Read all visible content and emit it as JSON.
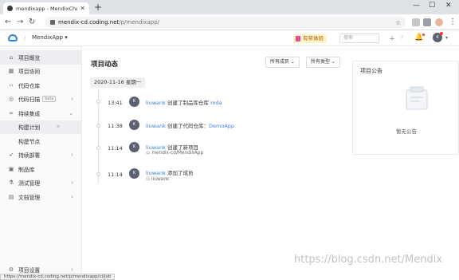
{
  "browser": {
    "tab_title": "mendixapp - MendixChengdu",
    "new_tab": "+",
    "url_host": "mendix-cd.coding.net",
    "url_path": "/p/mendixapp/",
    "window_controls": [
      "—",
      "☐",
      "✕"
    ],
    "status_url": "https://mendix-cd.coding.net/p/mendixapp/ci/job"
  },
  "header": {
    "project_name": "MendixApp",
    "promo_label": "有奖体验",
    "search_placeholder": "搜索",
    "user_initial": "K"
  },
  "sidebar": {
    "items": [
      {
        "label": "项目概览",
        "icon": "home-icon"
      },
      {
        "label": "项目协同",
        "icon": "calendar-icon"
      },
      {
        "label": "代码仓库",
        "icon": "code-icon"
      },
      {
        "label": "代码扫描",
        "icon": "scan-icon",
        "badge": "beta"
      },
      {
        "label": "持续集成",
        "icon": "infinity-icon"
      },
      {
        "label": "构建计划",
        "sub": true
      },
      {
        "label": "构建节点",
        "sub": true
      },
      {
        "label": "持续部署",
        "icon": "rocket-icon"
      },
      {
        "label": "制品库",
        "icon": "box-icon"
      },
      {
        "label": "测试管理",
        "icon": "flask-icon"
      },
      {
        "label": "文档管理",
        "icon": "doc-icon"
      }
    ],
    "footer_label": "项目设置"
  },
  "main": {
    "title": "项目动态",
    "filter_members": "所有成员",
    "filter_types": "所有类型",
    "date": "2020-11-16 星期一",
    "events": [
      {
        "time": "13:41",
        "avatar": "K",
        "user": "liuwank",
        "action": "创建了制品库仓库",
        "target": "mda",
        "detail": ""
      },
      {
        "time": "11:38",
        "avatar": "K",
        "user": "liuwank",
        "action": "创建了代码仓库：",
        "target": "DemoApp",
        "detail": ""
      },
      {
        "time": "11:14",
        "avatar": "K",
        "user": "liuwank",
        "action": "创建了新项目",
        "target": "",
        "detail": "mendix-cd/MendixApp"
      },
      {
        "time": "11:14",
        "avatar": "K",
        "user": "liuwank",
        "action": "添加了成员",
        "target": "",
        "detail": "liuwank"
      }
    ]
  },
  "notice": {
    "title": "项目公告",
    "empty": "暂无公告"
  },
  "watermark": "https://blog.csdn.net/Mendix"
}
